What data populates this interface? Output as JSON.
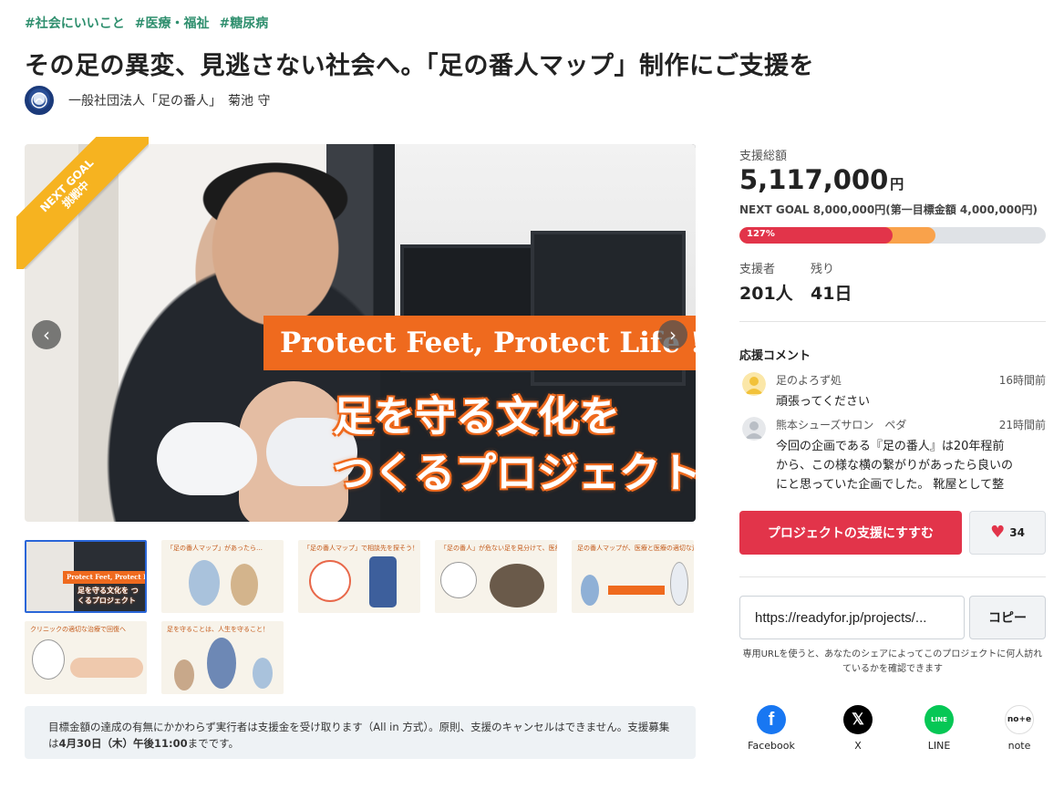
{
  "tags": [
    "#社会にいいこと",
    "#医療・福祉",
    "#糖尿病"
  ],
  "title": "その足の異変、見逃さない社会へ。「足の番人マップ」制作にご支援を",
  "owner": {
    "name": "一般社団法人「足の番人」　菊池 守"
  },
  "hero": {
    "ribbon_line1": "NEXT GOAL",
    "ribbon_line2": "挑戦中",
    "banner": "Protect Feet, Protect Life !",
    "catch_line1": "足を守る文化を",
    "catch_line2": "つくるプロジェクト"
  },
  "thumbnails": [
    {
      "title": "Protect Feet, Protect Life !",
      "sub": "足を守る文化を つくるプロジェクト"
    },
    {
      "title": "「足の番人マップ」があったら…"
    },
    {
      "title": "「足の番人マップ」で相談先を探そう！"
    },
    {
      "title": "「足の番人」が危ない足を見分けて、医療につなぐ"
    },
    {
      "title": "足の番人マップが、医療と医療の適切な連携をサポート"
    },
    {
      "title": "クリニックの適切な治療で回復へ"
    },
    {
      "title": "足を守ることは、人生を守ること！"
    }
  ],
  "notice": {
    "text_before": "目標金額の達成の有無にかかわらず実行者は支援金を受け取ります（All in 方式）。原則、支援のキャンセルはできません。支援募集は",
    "deadline": "4月30日（木）午後11:00",
    "text_after": "までです。"
  },
  "funding": {
    "total_label": "支援総額",
    "amount": "5,117,000",
    "unit": "円",
    "next_goal": "NEXT GOAL 8,000,000円(第一目標金額 4,000,000円)",
    "percent_label": "127%",
    "progress_of_next_goal": 0.64,
    "progress_of_first_goal_marker": 0.5,
    "supporters_label": "支援者",
    "supporters": "201人",
    "remaining_label": "残り",
    "remaining": "41日"
  },
  "comments": {
    "title": "応援コメント",
    "items": [
      {
        "name": "足のよろず処",
        "time": "16時間前",
        "text": "頑張ってください",
        "icon": "user-yellow-icon"
      },
      {
        "name": "熊本シューズサロン　ペダ",
        "time": "21時間前",
        "text": "今回の企画である『足の番人』は20年程前から、この様な横の繋がりがあったら良いのにと思っていた企画でした。 靴屋として整形外…",
        "icon": "user-gray-icon"
      }
    ]
  },
  "actions": {
    "support_label": "プロジェクトの支援にすすむ",
    "like_count": "34"
  },
  "share_url": {
    "value": "https://readyfor.jp/projects/...",
    "copy_label": "コピー",
    "note": "専用URLを使うと、あなたのシェアによってこのプロジェクトに何人訪れているかを確認できます"
  },
  "share": [
    {
      "label": "Facebook",
      "icon": "facebook-icon"
    },
    {
      "label": "X",
      "icon": "x-icon"
    },
    {
      "label": "LINE",
      "icon": "line-icon"
    },
    {
      "label": "note",
      "icon": "note-icon"
    }
  ],
  "colors": {
    "accent": "#e2344a",
    "tag": "#2f8f6e",
    "orange": "#ef6a1e",
    "ribbon": "#f6b320",
    "progress_next": "#f9a24b"
  }
}
